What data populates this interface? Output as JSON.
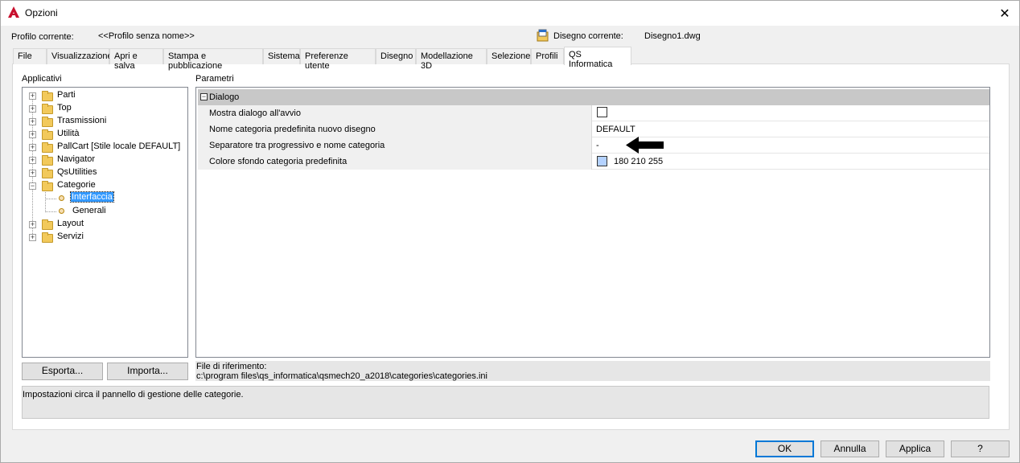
{
  "window": {
    "title": "Opzioni"
  },
  "profile": {
    "label": "Profilo corrente:",
    "value": "<<Profilo senza nome>>"
  },
  "drawing": {
    "label": "Disegno corrente:",
    "value": "Disegno1.dwg"
  },
  "tabs": [
    {
      "label": "File"
    },
    {
      "label": "Visualizzazione"
    },
    {
      "label": "Apri e salva"
    },
    {
      "label": "Stampa e pubblicazione"
    },
    {
      "label": "Sistema"
    },
    {
      "label": "Preferenze utente"
    },
    {
      "label": "Disegno"
    },
    {
      "label": "Modellazione 3D"
    },
    {
      "label": "Selezione"
    },
    {
      "label": "Profili"
    },
    {
      "label": "QS Informatica"
    }
  ],
  "left": {
    "title": "Applicativi",
    "tree": [
      {
        "label": "Parti"
      },
      {
        "label": "Top"
      },
      {
        "label": "Trasmissioni"
      },
      {
        "label": "Utilità"
      },
      {
        "label": "PallCart [Stile locale DEFAULT]"
      },
      {
        "label": "Navigator"
      },
      {
        "label": "QsUtilities"
      },
      {
        "label": "Categorie"
      },
      {
        "label": "Interfaccia"
      },
      {
        "label": "Generali"
      },
      {
        "label": "Layout"
      },
      {
        "label": "Servizi"
      }
    ],
    "export_label": "Esporta...",
    "import_label": "Importa..."
  },
  "params": {
    "title": "Parametri",
    "group": "Dialogo",
    "rows": [
      {
        "label": "Mostra dialogo all'avvio",
        "value": ""
      },
      {
        "label": "Nome categoria predefinita nuovo disegno",
        "value": "DEFAULT"
      },
      {
        "label": "Separatore tra progressivo e nome categoria",
        "value": "-"
      },
      {
        "label": "Colore sfondo categoria predefinita",
        "value": "180 210 255"
      }
    ],
    "swatch_color": "#b4d2ff"
  },
  "reference": {
    "label": "File di riferimento:",
    "path": "c:\\program files\\qs_informatica\\qsmech20_a2018\\categories\\categories.ini"
  },
  "description": "Impostazioni circa il pannello di gestione delle categorie.",
  "buttons": {
    "ok": "OK",
    "cancel": "Annulla",
    "apply": "Applica",
    "help": "?"
  }
}
